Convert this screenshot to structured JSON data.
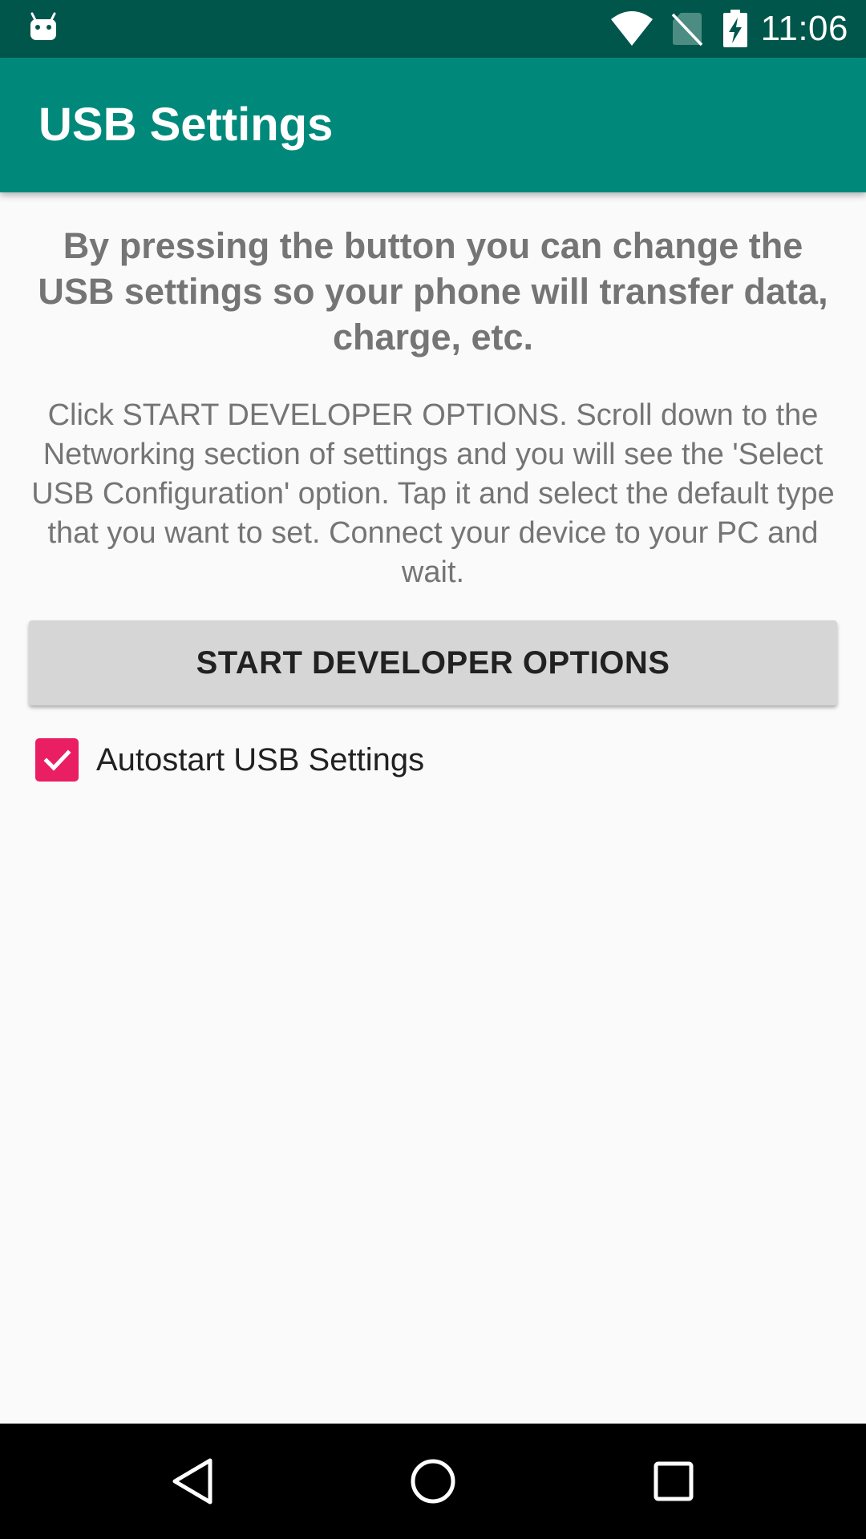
{
  "status_bar": {
    "time": "11:06",
    "icons": [
      "android-notification-icon",
      "wifi-icon",
      "no-sim-icon",
      "battery-charging-icon"
    ]
  },
  "app_bar": {
    "title": "USB Settings"
  },
  "main": {
    "headline": "By pressing the button you can change the USB settings so your phone will transfer data, charge, etc.",
    "instructions": "Click START DEVELOPER OPTIONS. Scroll down to the Networking section of settings and you will see the 'Select USB Configuration' option. Tap it and select the default type that you want to set. Connect your device to your PC and wait.",
    "button_label": "START DEVELOPER OPTIONS",
    "autostart": {
      "label": "Autostart USB Settings",
      "checked": true
    }
  },
  "nav_bar": {
    "icons": [
      "back-icon",
      "home-icon",
      "recents-icon"
    ]
  },
  "colors": {
    "status_bar": "#00564b",
    "app_bar": "#00897b",
    "accent": "#e91e63",
    "button": "#d6d6d6",
    "secondary_text": "#757575",
    "primary_text": "#212121"
  }
}
